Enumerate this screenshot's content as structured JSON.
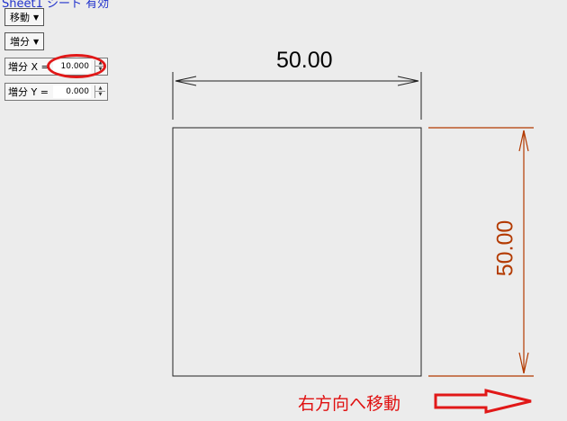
{
  "sheet": {
    "label": "Sheet1 シート 有効"
  },
  "toolbar": {
    "move_dropdown": "移動",
    "increment_dropdown": "増分"
  },
  "increment_x": {
    "label": "増分 X =",
    "value": "10.000"
  },
  "increment_y": {
    "label": "増分 Y =",
    "value": "0.000"
  },
  "drawing": {
    "width_dimension": "50.00",
    "height_dimension": "50.00",
    "move_instruction": "右方向へ移動"
  },
  "colors": {
    "callout": "#e11818",
    "dimension_right": "#b33a00",
    "instruction": "#e01010"
  }
}
